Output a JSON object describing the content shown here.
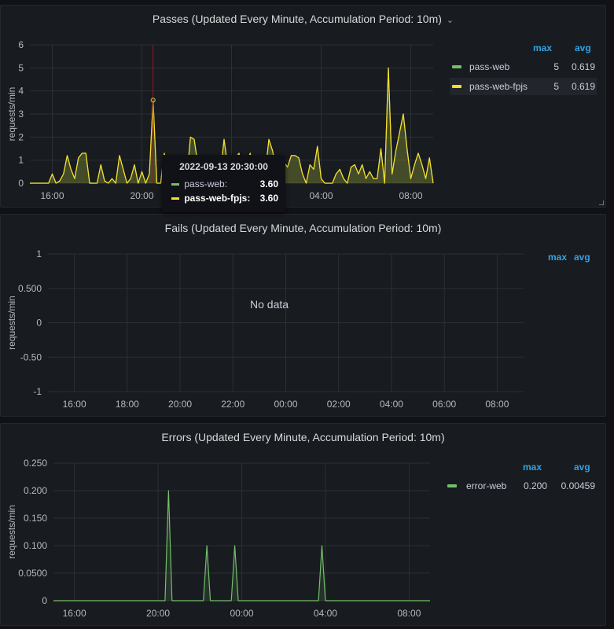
{
  "panels": [
    {
      "title": "Passes (Updated Every Minute, Accumulation Period: 10m)",
      "legend": {
        "headers": [
          "max",
          "avg"
        ],
        "rows": [
          {
            "name": "pass-web",
            "max": "5",
            "avg": "0.619",
            "color": "#73bf69"
          },
          {
            "name": "pass-web-fpjs",
            "max": "5",
            "avg": "0.619",
            "color": "#fade2a",
            "highlighted": true
          }
        ]
      },
      "tooltip": {
        "time": "2022-09-13 20:30:00",
        "rows": [
          {
            "name": "pass-web:",
            "value": "3.60",
            "color": "#73bf69"
          },
          {
            "name": "pass-web-fpjs:",
            "value": "3.60",
            "color": "#fade2a"
          }
        ]
      },
      "chevron_icon": "chevron-down-icon"
    },
    {
      "title": "Fails (Updated Every Minute, Accumulation Period: 10m)",
      "legend": {
        "headers": [
          "max",
          "avg"
        ],
        "rows": []
      },
      "no_data": "No data"
    },
    {
      "title": "Errors (Updated Every Minute, Accumulation Period: 10m)",
      "legend": {
        "headers": [
          "max",
          "avg"
        ],
        "rows": [
          {
            "name": "error-web",
            "max": "0.200",
            "avg": "0.00459",
            "color": "#73bf69"
          }
        ]
      }
    }
  ],
  "chart_data": [
    {
      "type": "area",
      "title": "Passes (Updated Every Minute, Accumulation Period: 10m)",
      "ylabel": "requests/min",
      "xlim": [
        "15:00",
        "09:00"
      ],
      "ylim": [
        0,
        6
      ],
      "yticks": [
        "0",
        "1",
        "2",
        "3",
        "4",
        "5",
        "6"
      ],
      "xticks": [
        "16:00",
        "20:00",
        "00:00",
        "04:00",
        "08:00"
      ],
      "xtick_labels_visible": [
        "16:00",
        "20:00",
        "04:00",
        "08:00"
      ],
      "grid": true,
      "legend": "right",
      "crosshair": "20:30",
      "x": [
        "15:00",
        "15:10",
        "15:20",
        "15:30",
        "15:40",
        "15:50",
        "16:00",
        "16:10",
        "16:20",
        "16:30",
        "16:40",
        "16:50",
        "17:00",
        "17:10",
        "17:20",
        "17:30",
        "17:40",
        "17:50",
        "18:00",
        "18:10",
        "18:20",
        "18:30",
        "18:40",
        "18:50",
        "19:00",
        "19:10",
        "19:20",
        "19:30",
        "19:40",
        "19:50",
        "20:00",
        "20:10",
        "20:20",
        "20:30",
        "20:40",
        "20:50",
        "21:00",
        "21:10",
        "21:20",
        "21:30",
        "21:40",
        "21:50",
        "22:00",
        "22:10",
        "22:20",
        "22:30",
        "22:40",
        "22:50",
        "23:00",
        "23:10",
        "23:20",
        "23:30",
        "23:40",
        "23:50",
        "00:00",
        "00:10",
        "00:20",
        "00:30",
        "00:40",
        "00:50",
        "01:00",
        "01:10",
        "01:20",
        "01:30",
        "01:40",
        "01:50",
        "02:00",
        "02:10",
        "02:20",
        "02:30",
        "02:40",
        "02:50",
        "03:00",
        "03:10",
        "03:20",
        "03:30",
        "03:40",
        "03:50",
        "04:00",
        "04:10",
        "04:20",
        "04:30",
        "04:40",
        "04:50",
        "05:00",
        "05:10",
        "05:20",
        "05:30",
        "05:40",
        "05:50",
        "06:00",
        "06:10",
        "06:20",
        "06:30",
        "06:40",
        "06:50",
        "07:00",
        "07:10",
        "07:20",
        "07:30",
        "07:40",
        "07:50",
        "08:00",
        "08:10",
        "08:20",
        "08:30",
        "08:40",
        "08:50",
        "09:00"
      ],
      "series": [
        {
          "name": "pass-web",
          "color": "#73bf69",
          "values": [
            0,
            0,
            0,
            0,
            0,
            0,
            0.4,
            0,
            0.1,
            0.4,
            1.2,
            0.6,
            0.2,
            1.1,
            1.3,
            1.3,
            0,
            0,
            0,
            0.8,
            0.1,
            0,
            0.2,
            0,
            1.2,
            0.6,
            0,
            0.2,
            0.8,
            0,
            0.5,
            0,
            0.4,
            3.6,
            0,
            0,
            1.3,
            0,
            1.0,
            0.6,
            1.1,
            0.5,
            0.2,
            2.0,
            1.9,
            0.8,
            0.3,
            1.0,
            0.6,
            0.2,
            0.9,
            0.4,
            1.9,
            0.7,
            0.4,
            1.1,
            1.3,
            0.6,
            0.9,
            1.3,
            0.5,
            0.2,
            0.8,
            0.4,
            1.9,
            1.4,
            0.5,
            1.0,
            0.9,
            0.7,
            1.2,
            1.2,
            1.1,
            0.4,
            0,
            0.8,
            0.6,
            1.6,
            0.2,
            0,
            0,
            0,
            0.4,
            0.6,
            0.2,
            0,
            0.7,
            0.8,
            0.4,
            0.8,
            0.2,
            0.5,
            0.2,
            0.2,
            1.5,
            0,
            5,
            0.4,
            1.4,
            2.2,
            3.0,
            1.5,
            0.2,
            0.8,
            1.3,
            0.8,
            0.2,
            1.1,
            0
          ]
        },
        {
          "name": "pass-web-fpjs",
          "color": "#fade2a",
          "values": [
            0,
            0,
            0,
            0,
            0,
            0,
            0.4,
            0,
            0.1,
            0.4,
            1.2,
            0.6,
            0.2,
            1.1,
            1.3,
            1.3,
            0,
            0,
            0,
            0.8,
            0.1,
            0,
            0.2,
            0,
            1.2,
            0.6,
            0,
            0.2,
            0.8,
            0,
            0.5,
            0,
            0.4,
            3.6,
            0,
            0,
            1.3,
            0,
            1.0,
            0.6,
            1.1,
            0.5,
            0.2,
            2.0,
            1.9,
            0.8,
            0.3,
            1.0,
            0.6,
            0.2,
            0.9,
            0.4,
            1.9,
            0.7,
            0.4,
            1.1,
            1.3,
            0.6,
            0.9,
            1.3,
            0.5,
            0.2,
            0.8,
            0.4,
            1.9,
            1.4,
            0.5,
            1.0,
            0.9,
            0.7,
            1.2,
            1.2,
            1.1,
            0.4,
            0,
            0.8,
            0.6,
            1.6,
            0.2,
            0,
            0,
            0,
            0.4,
            0.6,
            0.2,
            0,
            0.7,
            0.8,
            0.4,
            0.8,
            0.2,
            0.5,
            0.2,
            0.2,
            1.5,
            0,
            5,
            0.4,
            1.4,
            2.2,
            3.0,
            1.5,
            0.2,
            0.8,
            1.3,
            0.8,
            0.2,
            1.1,
            0
          ]
        }
      ]
    },
    {
      "type": "line",
      "title": "Fails (Updated Every Minute, Accumulation Period: 10m)",
      "ylabel": "requests/min",
      "xlim": [
        "15:00",
        "09:00"
      ],
      "ylim": [
        -1,
        1
      ],
      "yticks": [
        "-1",
        "-0.50",
        "0",
        "0.500",
        "1"
      ],
      "xticks": [
        "16:00",
        "18:00",
        "20:00",
        "22:00",
        "00:00",
        "02:00",
        "04:00",
        "06:00",
        "08:00"
      ],
      "xtick_labels_visible": [
        "16:00",
        "18:00",
        "20:00",
        "22:00",
        "00:00",
        "02:00",
        "04:00",
        "06:00",
        "08:00"
      ],
      "grid": true,
      "legend": "right",
      "series": []
    },
    {
      "type": "area",
      "title": "Errors (Updated Every Minute, Accumulation Period: 10m)",
      "ylabel": "requests/min",
      "xlim": [
        "15:00",
        "09:00"
      ],
      "ylim": [
        0,
        0.25
      ],
      "yticks": [
        "0",
        "0.0500",
        "0.100",
        "0.150",
        "0.200",
        "0.250"
      ],
      "xticks": [
        "16:00",
        "20:00",
        "00:00",
        "04:00",
        "08:00"
      ],
      "xtick_labels_visible": [
        "16:00",
        "20:00",
        "00:00",
        "04:00",
        "08:00"
      ],
      "grid": true,
      "legend": "right",
      "x": [
        "15:00",
        "20:20",
        "20:30",
        "20:40",
        "22:10",
        "22:20",
        "22:30",
        "23:30",
        "23:40",
        "23:50",
        "03:40",
        "03:50",
        "04:00",
        "09:00"
      ],
      "series": [
        {
          "name": "error-web",
          "color": "#73bf69",
          "values": [
            0,
            0,
            0.2,
            0,
            0,
            0.1,
            0,
            0,
            0.1,
            0,
            0,
            0.1,
            0,
            0
          ]
        }
      ]
    }
  ]
}
